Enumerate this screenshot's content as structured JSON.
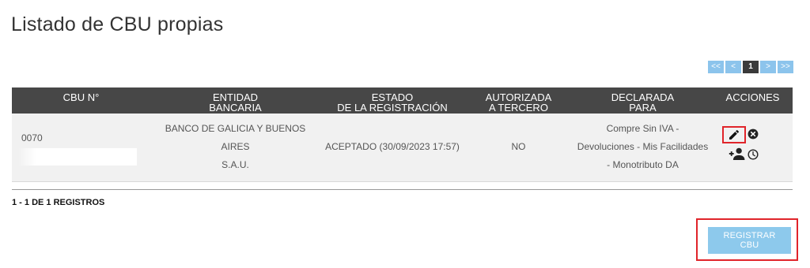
{
  "page": {
    "title": "Listado de CBU propias"
  },
  "pagination": {
    "first": "<<",
    "prev": "<",
    "current": "1",
    "next": ">",
    "last": ">>"
  },
  "table": {
    "headers": {
      "cbu": "CBU N°",
      "entidad_l1": "ENTIDAD",
      "entidad_l2": "BANCARIA",
      "estado_l1": "ESTADO",
      "estado_l2": "DE LA REGISTRACIÓN",
      "autorizada_l1": "AUTORIZADA",
      "autorizada_l2": "A TERCERO",
      "declarada_l1": "DECLARADA",
      "declarada_l2": "PARA",
      "acciones": "ACCIONES"
    },
    "rows": [
      {
        "cbu_prefix": "0070",
        "entidad_l1": "BANCO DE GALICIA Y BUENOS AIRES",
        "entidad_l2": "S.A.U.",
        "estado": "ACEPTADO (30/09/2023 17:57)",
        "autorizada": "NO",
        "declarada_l1": "Compre Sin IVA -",
        "declarada_l2": "Devoluciones - Mis Facilidades",
        "declarada_l3": "- Monotributo DA",
        "icons": [
          "edit-icon",
          "delete-icon",
          "add-person-icon",
          "clock-icon"
        ]
      }
    ]
  },
  "footer": {
    "records": "1 - 1 DE 1 REGISTROS",
    "register_button": "REGISTRAR CBU"
  },
  "colors": {
    "header_bg": "#474747",
    "row_bg": "#f1f1f1",
    "accent": "#8dc9ec",
    "highlight": "#e0242a"
  }
}
